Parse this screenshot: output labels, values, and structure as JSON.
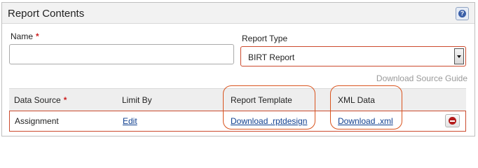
{
  "panel": {
    "title": "Report Contents",
    "help_icon": "help-icon",
    "help_glyph": "?"
  },
  "form": {
    "name_label": "Name",
    "required_marker": "*",
    "name_value": "",
    "report_type_label": "Report Type",
    "report_type_value": "BIRT Report",
    "download_guide_link": "Download Source Guide"
  },
  "table": {
    "headers": {
      "data_source": "Data Source",
      "limit_by": "Limit By",
      "report_template": "Report Template",
      "xml_data": "XML Data"
    },
    "rows": [
      {
        "data_source": "Assignment",
        "limit_by": "Edit",
        "report_template": "Download .rptdesign",
        "xml_data": "Download .xml",
        "remove_icon": "remove-icon"
      }
    ]
  },
  "colors": {
    "annotation": "#d9541e",
    "required": "#cc1f1f",
    "link": "#0f3f8f"
  }
}
